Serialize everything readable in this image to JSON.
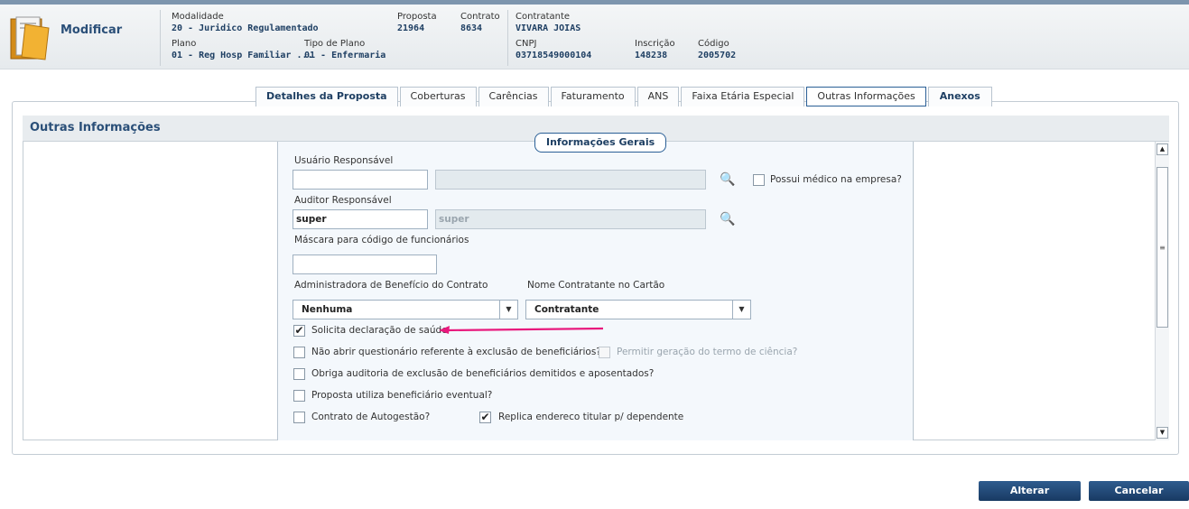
{
  "header": {
    "title": "Modificar",
    "modalidade": {
      "label": "Modalidade",
      "value": "20 - Juridico Regulamentado"
    },
    "proposta": {
      "label": "Proposta",
      "value": "21964"
    },
    "contrato": {
      "label": "Contrato",
      "value": "8634"
    },
    "contratante": {
      "label": "Contratante",
      "value": "VIVARA JOIAS"
    },
    "plano": {
      "label": "Plano",
      "value": "01 - Reg Hosp Familiar ..."
    },
    "tipo_plano": {
      "label": "Tipo de Plano",
      "value": "01 - Enfermaria"
    },
    "cnpj": {
      "label": "CNPJ",
      "value": "03718549000104"
    },
    "inscricao": {
      "label": "Inscrição",
      "value": "148238"
    },
    "codigo": {
      "label": "Código",
      "value": "2005702"
    }
  },
  "tabs": [
    {
      "label": "Detalhes da Proposta"
    },
    {
      "label": "Coberturas"
    },
    {
      "label": "Carências"
    },
    {
      "label": "Faturamento"
    },
    {
      "label": "ANS"
    },
    {
      "label": "Faixa Etária Especial"
    },
    {
      "label": "Outras Informações"
    },
    {
      "label": "Anexos"
    }
  ],
  "section": {
    "title": "Outras Informações",
    "group_title": "Informações Gerais"
  },
  "form": {
    "usuario_label": "Usuário Responsável",
    "usuario_value": "",
    "usuario_desc": "",
    "possui_medico_label": "Possui médico na empresa?",
    "auditor_label": "Auditor Responsável",
    "auditor_value": "super",
    "auditor_desc": "super",
    "mascara_label": "Máscara para código de funcionários",
    "mascara_value": "",
    "admin_label": "Administradora de Benefício do Contrato",
    "admin_value": "Nenhuma",
    "nome_cartao_label": "Nome Contratante no Cartão",
    "nome_cartao_value": "Contratante",
    "solicita_label": "Solicita declaração de saúde",
    "nao_abrir_label": "Não abrir questionário referente à exclusão de beneficiários?",
    "permitir_label": "Permitir geração do termo de ciência?",
    "obriga_label": "Obriga auditoria de exclusão de beneficiários demitidos e aposentados?",
    "proposta_util_label": "Proposta utiliza beneficiário eventual?",
    "autogestao_label": "Contrato de Autogestão?",
    "replica_label": "Replica endereco titular p/ dependente"
  },
  "checks": {
    "possui_medico": false,
    "solicita": true,
    "nao_abrir": false,
    "permitir": false,
    "obriga": false,
    "proposta_util": false,
    "autogestao": false,
    "replica": true
  },
  "icons": {
    "check": "✔",
    "scroll_up": "▲",
    "scroll_down": "▼",
    "dropdown": "▼",
    "grip": "≡",
    "magnifier": "🔍"
  },
  "colors": {
    "accent": "#2a4f78",
    "annotation_arrow": "#e8197d"
  },
  "buttons": {
    "alterar": "Alterar",
    "cancelar": "Cancelar"
  }
}
